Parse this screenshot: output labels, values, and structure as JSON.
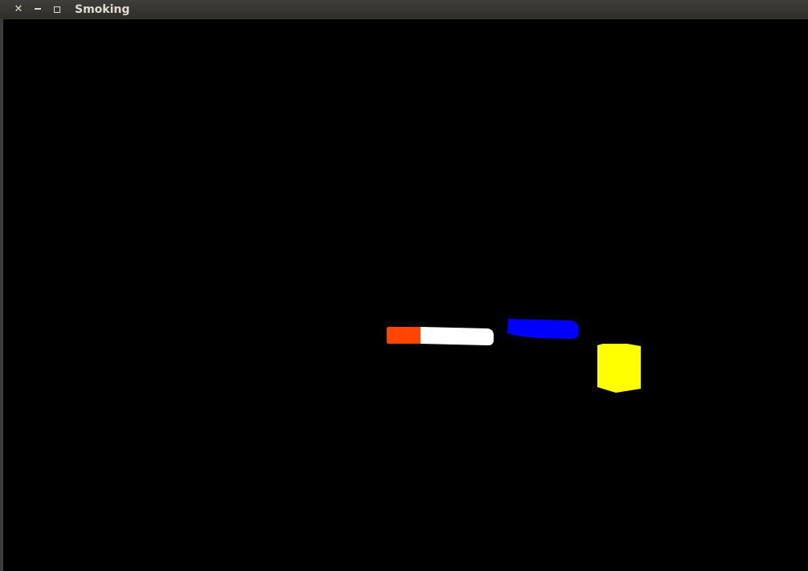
{
  "window": {
    "title": "Smoking",
    "controls": {
      "close_icon": "close-icon",
      "minimize_icon": "minimize-icon",
      "maximize_icon": "maximize-icon",
      "close_glyph": "✕"
    }
  },
  "scene": {
    "background": "#000000",
    "colors": {
      "cigarette_tip": "#ff4500",
      "cigarette_body": "#ffffff",
      "blue_object": "#0000ff",
      "yellow_object": "#ffff00"
    }
  }
}
